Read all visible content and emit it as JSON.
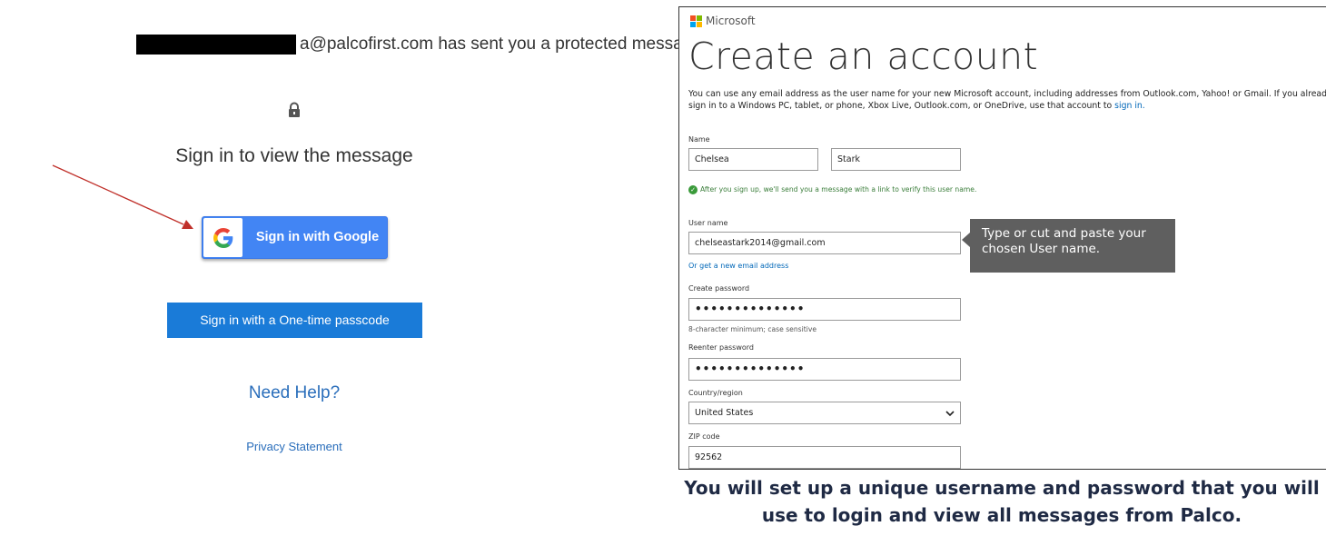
{
  "left": {
    "sender_text": "a@palcofirst.com has sent you a protected message",
    "heading": "Sign in to view the message",
    "google_button": "Sign in with Google",
    "passcode_button": "Sign in with a One-time passcode",
    "need_help": "Need Help?",
    "privacy": "Privacy Statement",
    "colors": {
      "google_blue": "#4285f4",
      "passcode_blue": "#1a7bd8",
      "link": "#2a6ebb",
      "arrow": "#c0302a"
    }
  },
  "microsoft": {
    "brand": "Microsoft",
    "title": "Create an account",
    "intro_text": "You can use any email address as the user name for your new Microsoft account, including addresses from Outlook.com, Yahoo! or Gmail. If you already sign in to a Windows PC, tablet, or phone, Xbox Live, Outlook.com, or OneDrive, use that account to ",
    "intro_link": "sign in.",
    "name_label": "Name",
    "first_name": "Chelsea",
    "last_name": "Stark",
    "verify_note": "After you sign up, we'll send you a message with a link to verify this user name.",
    "username_label": "User name",
    "username_value": "chelseastark2014@gmail.com",
    "tooltip": "Type or cut and paste your chosen User name.",
    "new_email_link": "Or get a new email address",
    "create_password_label": "Create password",
    "password_dots": "••••••••••••••",
    "password_hint": "8-character minimum; case sensitive",
    "reenter_password_label": "Reenter password",
    "reenter_dots": "••••••••••••••",
    "country_label": "Country/region",
    "country_value": "United States",
    "zip_label": "ZIP code",
    "zip_value": "92562",
    "logo_colors": [
      "#f25022",
      "#7fba00",
      "#00a4ef",
      "#ffb900"
    ]
  },
  "caption": "You will set up a unique username and password that you will use to login and view all messages from Palco."
}
